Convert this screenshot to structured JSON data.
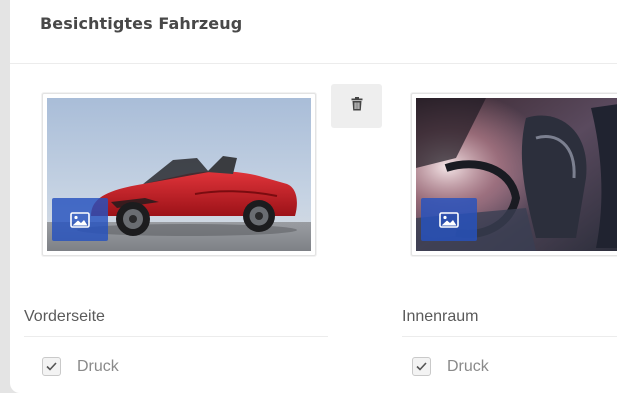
{
  "section": {
    "title": "Besichtigtes Fahrzeug"
  },
  "images": [
    {
      "label": "Vorderseite",
      "print_label": "Druck",
      "print_checked": true,
      "image_icon": "image-icon"
    },
    {
      "label": "Innenraum",
      "print_label": "Druck",
      "print_checked": true,
      "image_icon": "image-icon"
    }
  ],
  "actions": {
    "delete_icon": "trash-icon"
  },
  "colors": {
    "accent": "#2652be",
    "title": "#484848",
    "label": "#5a5a5a",
    "car_red": "#c41f26"
  }
}
